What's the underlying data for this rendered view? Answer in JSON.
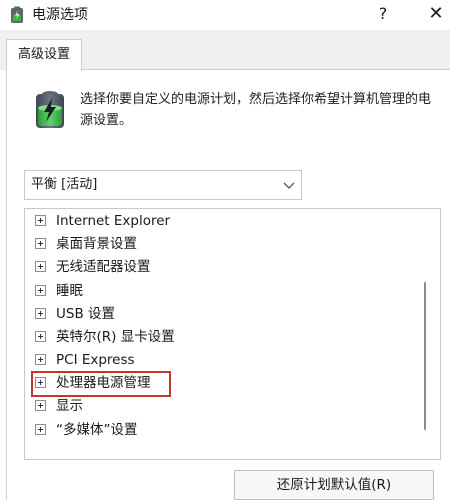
{
  "window": {
    "title": "电源选项",
    "help_glyph": "?",
    "close_glyph": "✕",
    "app_icon": "power-options-icon"
  },
  "tabs": [
    {
      "label": "高级设置",
      "active": true
    }
  ],
  "description": "选择你要自定义的电源计划，然后选择你希望计算机管理的电源设置。",
  "plan_select": {
    "value": "平衡 [活动]",
    "icon": "chevron-down-icon"
  },
  "tree": {
    "items": [
      {
        "label": "Internet Explorer"
      },
      {
        "label": "桌面背景设置"
      },
      {
        "label": "无线适配器设置"
      },
      {
        "label": "睡眠"
      },
      {
        "label": "USB 设置"
      },
      {
        "label": "英特尔(R) 显卡设置"
      },
      {
        "label": "PCI Express"
      },
      {
        "label": "处理器电源管理",
        "highlighted": true
      },
      {
        "label": "显示"
      },
      {
        "label": "“多媒体”设置"
      }
    ],
    "expand_icon": "expand-plus-icon"
  },
  "buttons": {
    "restore": "还原计划默认值(R)"
  },
  "colors": {
    "highlight_border": "#c0392b",
    "battery_green": "#3bb54a",
    "tab_strip": "#f0f0f0"
  }
}
